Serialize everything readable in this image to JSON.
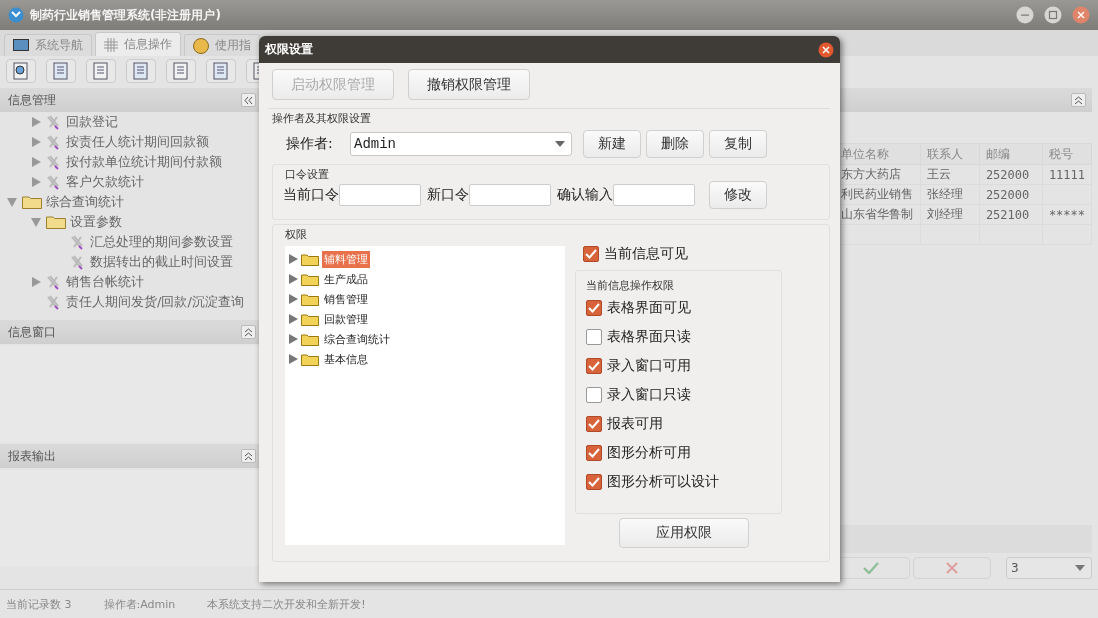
{
  "window": {
    "title": "制药行业销售管理系统(非注册用户)"
  },
  "tabs": [
    {
      "label": "系统导航",
      "selected": false
    },
    {
      "label": "信息操作",
      "selected": true
    },
    {
      "label": "使用指",
      "selected": false
    }
  ],
  "left_panel": {
    "title": "信息管理",
    "partial_branch": [
      {
        "label": "回款登记",
        "kind": "task",
        "expanded": false
      },
      {
        "label": "按责任人统计期间回款额",
        "kind": "task",
        "expanded": false
      },
      {
        "label": "按付款单位统计期间付款额",
        "kind": "task",
        "expanded": false
      },
      {
        "label": "客户欠款统计",
        "kind": "task",
        "expanded": false
      }
    ],
    "nodes": [
      {
        "label": "综合查询统计",
        "kind": "folder",
        "expanded": true,
        "children": [
          {
            "label": "设置参数",
            "kind": "folder",
            "expanded": true,
            "children": [
              {
                "label": "汇总处理的期间参数设置",
                "kind": "task"
              },
              {
                "label": "数据转出的截止时间设置",
                "kind": "task"
              }
            ]
          },
          {
            "label": "销售台帐统计",
            "kind": "task",
            "expanded": false
          },
          {
            "label": "责任人期间发货/回款/沉淀查询",
            "kind": "task"
          }
        ]
      }
    ]
  },
  "info_panel": {
    "title": "信息窗口"
  },
  "report_panel": {
    "title": "报表输出"
  },
  "table": {
    "columns": [
      "单位名称",
      "联系人",
      "邮编",
      "税号"
    ],
    "rows": [
      [
        "东方大药店",
        "王云",
        "252000",
        "11111"
      ],
      [
        "利民药业销售",
        "张经理",
        "252000",
        ""
      ],
      [
        "山东省华鲁制",
        "刘经理",
        "252100",
        "*****"
      ]
    ]
  },
  "page_size": {
    "value": "3"
  },
  "dialog": {
    "title": "权限设置",
    "top_buttons": [
      {
        "label": "启动权限管理",
        "disabled": true
      },
      {
        "label": "撤销权限管理",
        "disabled": false
      }
    ],
    "operator_section": "操作者及其权限设置",
    "operator_label": "操作者:",
    "operator_value": "Admin",
    "operator_buttons": [
      "新建",
      "删除",
      "复制"
    ],
    "password": {
      "title": "口令设置",
      "fields": [
        {
          "label": "当前口令"
        },
        {
          "label": "新口令"
        },
        {
          "label": "确认输入"
        }
      ],
      "button": "修改"
    },
    "permissions": {
      "title": "权限",
      "tree": [
        {
          "label": "辅料管理",
          "selected": true
        },
        {
          "label": "生产成品",
          "selected": false
        },
        {
          "label": "销售管理",
          "selected": false
        },
        {
          "label": "回款管理",
          "selected": false
        },
        {
          "label": "综合查询统计",
          "selected": false
        },
        {
          "label": "基本信息",
          "selected": false
        }
      ],
      "visible": {
        "label": "当前信息可见",
        "checked": true
      },
      "ops_title": "当前信息操作权限",
      "ops": [
        {
          "label": "表格界面可见",
          "checked": true
        },
        {
          "label": "表格界面只读",
          "checked": false
        },
        {
          "label": "录入窗口可用",
          "checked": true
        },
        {
          "label": "录入窗口只读",
          "checked": false
        },
        {
          "label": "报表可用",
          "checked": true
        },
        {
          "label": "图形分析可用",
          "checked": true
        },
        {
          "label": "图形分析可以设计",
          "checked": true
        }
      ],
      "apply": "应用权限"
    }
  },
  "status_bar": [
    "当前记录数 3",
    "操作者:Admin",
    "本系统支持二次开发和全新开发!"
  ]
}
